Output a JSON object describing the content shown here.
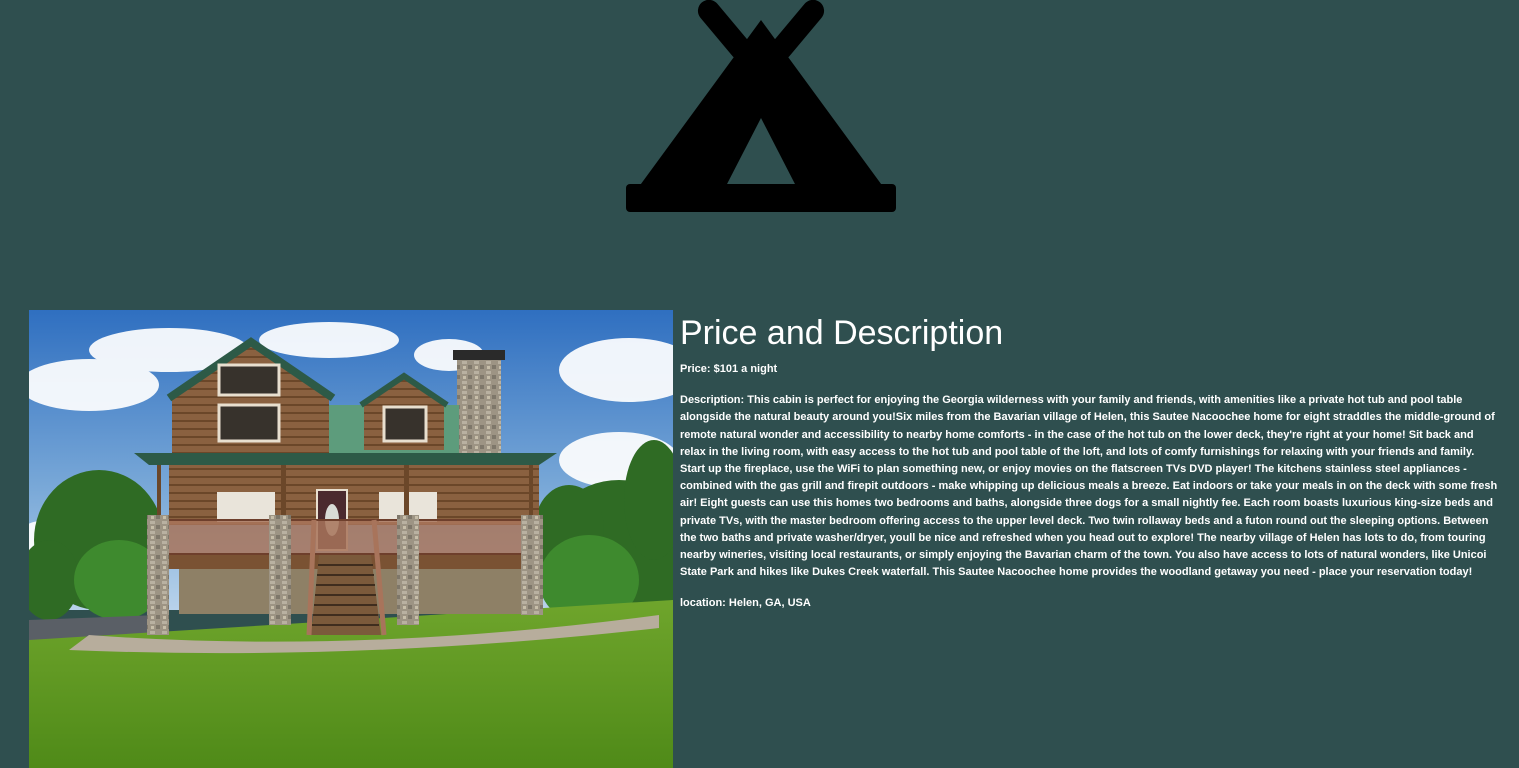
{
  "header": {
    "logo_icon": "camping-tent-icon",
    "logo_color": "#000000"
  },
  "colors": {
    "background": "#2f4f4f",
    "text": "#ffffff"
  },
  "listing": {
    "image": "cabin-photo",
    "heading": "Price and Description",
    "price": "Price: $101 a night",
    "description": "Description: This cabin is perfect for enjoying the Georgia wilderness with your family and friends, with amenities like a private hot tub and pool table alongside the natural beauty around you!Six miles from the Bavarian village of Helen, this Sautee Nacoochee home for eight straddles the middle-ground of remote natural wonder and accessibility to nearby home comforts - in the case of the hot tub on the lower deck, they're right at your home! Sit back and relax in the living room, with easy access to the hot tub and pool table of the loft, and lots of comfy furnishings for relaxing with your friends and family. Start up the fireplace, use the WiFi to plan something new, or enjoy movies on the flatscreen TVs DVD player! The kitchens stainless steel appliances - combined with the gas grill and firepit outdoors - make whipping up delicious meals a breeze. Eat indoors or take your meals in on the deck with some fresh air! Eight guests can use this homes two bedrooms and baths, alongside three dogs for a small nightly fee. Each room boasts luxurious king-size beds and private TVs, with the master bedroom offering access to the upper level deck. Two twin rollaway beds and a futon round out the sleeping options. Between the two baths and private washer/dryer, youll be nice and refreshed when you head out to explore! The nearby village of Helen has lots to do, from touring nearby wineries, visiting local restaurants, or simply enjoying the Bavarian charm of the town. You also have access to lots of natural wonders, like Unicoi State Park and hikes like Dukes Creek waterfall. This Sautee Nacoochee home provides the woodland getaway you need - place your reservation today!",
    "location": "location: Helen, GA, USA"
  }
}
